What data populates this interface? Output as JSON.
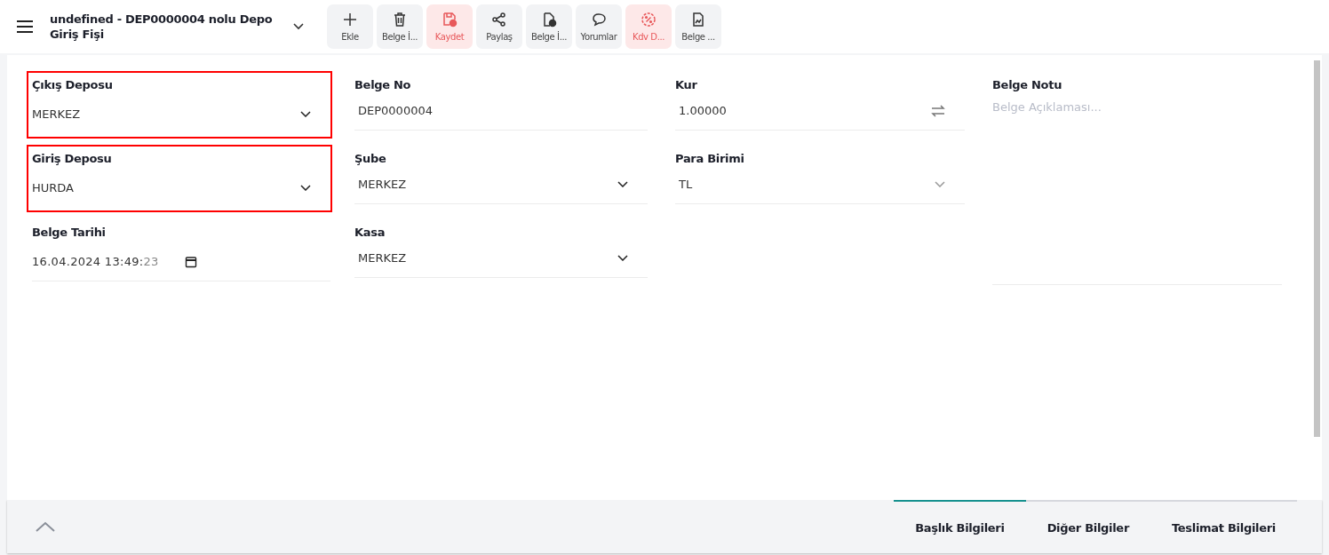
{
  "header": {
    "title": "undefined - DEP0000004 nolu Depo Giriş Fişi"
  },
  "toolbar": [
    {
      "label": "Ekle",
      "kind": "plus",
      "highlighted": false
    },
    {
      "label": "Belge İ...",
      "kind": "trash",
      "highlighted": false
    },
    {
      "label": "Kaydet",
      "kind": "save",
      "highlighted": true
    },
    {
      "label": "Paylaş",
      "kind": "share",
      "highlighted": false
    },
    {
      "label": "Belge İ...",
      "kind": "doc-check",
      "highlighted": false
    },
    {
      "label": "Yorumlar",
      "kind": "comment",
      "highlighted": false
    },
    {
      "label": "Kdv D...",
      "kind": "percent",
      "highlighted": true
    },
    {
      "label": "Belge ...",
      "kind": "doc",
      "highlighted": false
    }
  ],
  "columns": [
    [
      {
        "label": "Çıkış Deposu",
        "kind": "select",
        "value": "MERKEZ",
        "highlighted": true
      },
      {
        "label": "Giriş Deposu",
        "kind": "select",
        "value": "HURDA",
        "highlighted": true
      },
      {
        "label": "Belge Tarihi",
        "kind": "date",
        "value": "16.04.2024 13:49:",
        "seconds": "23",
        "highlighted": false
      }
    ],
    [
      {
        "label": "Belge No",
        "kind": "text",
        "value": "DEP0000004",
        "highlighted": false
      },
      {
        "label": "Şube",
        "kind": "select",
        "value": "MERKEZ",
        "highlighted": false
      },
      {
        "label": "Kasa",
        "kind": "select",
        "value": "MERKEZ",
        "highlighted": false
      }
    ],
    [
      {
        "label": "Kur",
        "kind": "rate",
        "value": "1.00000",
        "highlighted": false
      },
      {
        "label": "Para Birimi",
        "kind": "select-light",
        "value": "TL",
        "highlighted": false
      }
    ]
  ],
  "note": {
    "label": "Belge Notu",
    "placeholder": "Belge Açıklaması..."
  },
  "tabs": [
    {
      "label": "Başlık Bilgileri",
      "selected": true
    },
    {
      "label": "Diğer Bilgiler",
      "selected": false
    },
    {
      "label": "Teslimat Bilgileri",
      "selected": false
    }
  ]
}
